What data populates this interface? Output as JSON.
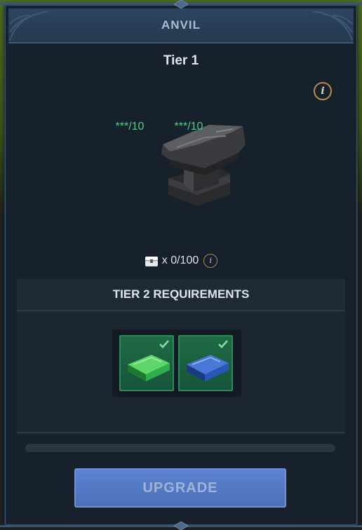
{
  "window": {
    "title": "ANVIL"
  },
  "building": {
    "tier_title": "Tier 1",
    "info_label": "i",
    "image": "anvil-icon"
  },
  "capacity": {
    "icon": "chest-icon",
    "text": "x 0/100",
    "info_label": "i"
  },
  "requirements": {
    "header": "TIER 2 REQUIREMENTS",
    "items": [
      {
        "icon": "green-bar-icon",
        "quantity": "***/10",
        "met": true,
        "color": "#2fae4e"
      },
      {
        "icon": "blue-bar-icon",
        "quantity": "***/10",
        "met": true,
        "color": "#2a56b8"
      }
    ]
  },
  "progress": {
    "fraction": 0
  },
  "upgrade": {
    "label": "UPGRADE"
  },
  "colors": {
    "accent_blue": "#5a7ec8",
    "check_green": "#59c98a",
    "info_gold": "#b18d4c",
    "panel_bg": "#17212b"
  }
}
